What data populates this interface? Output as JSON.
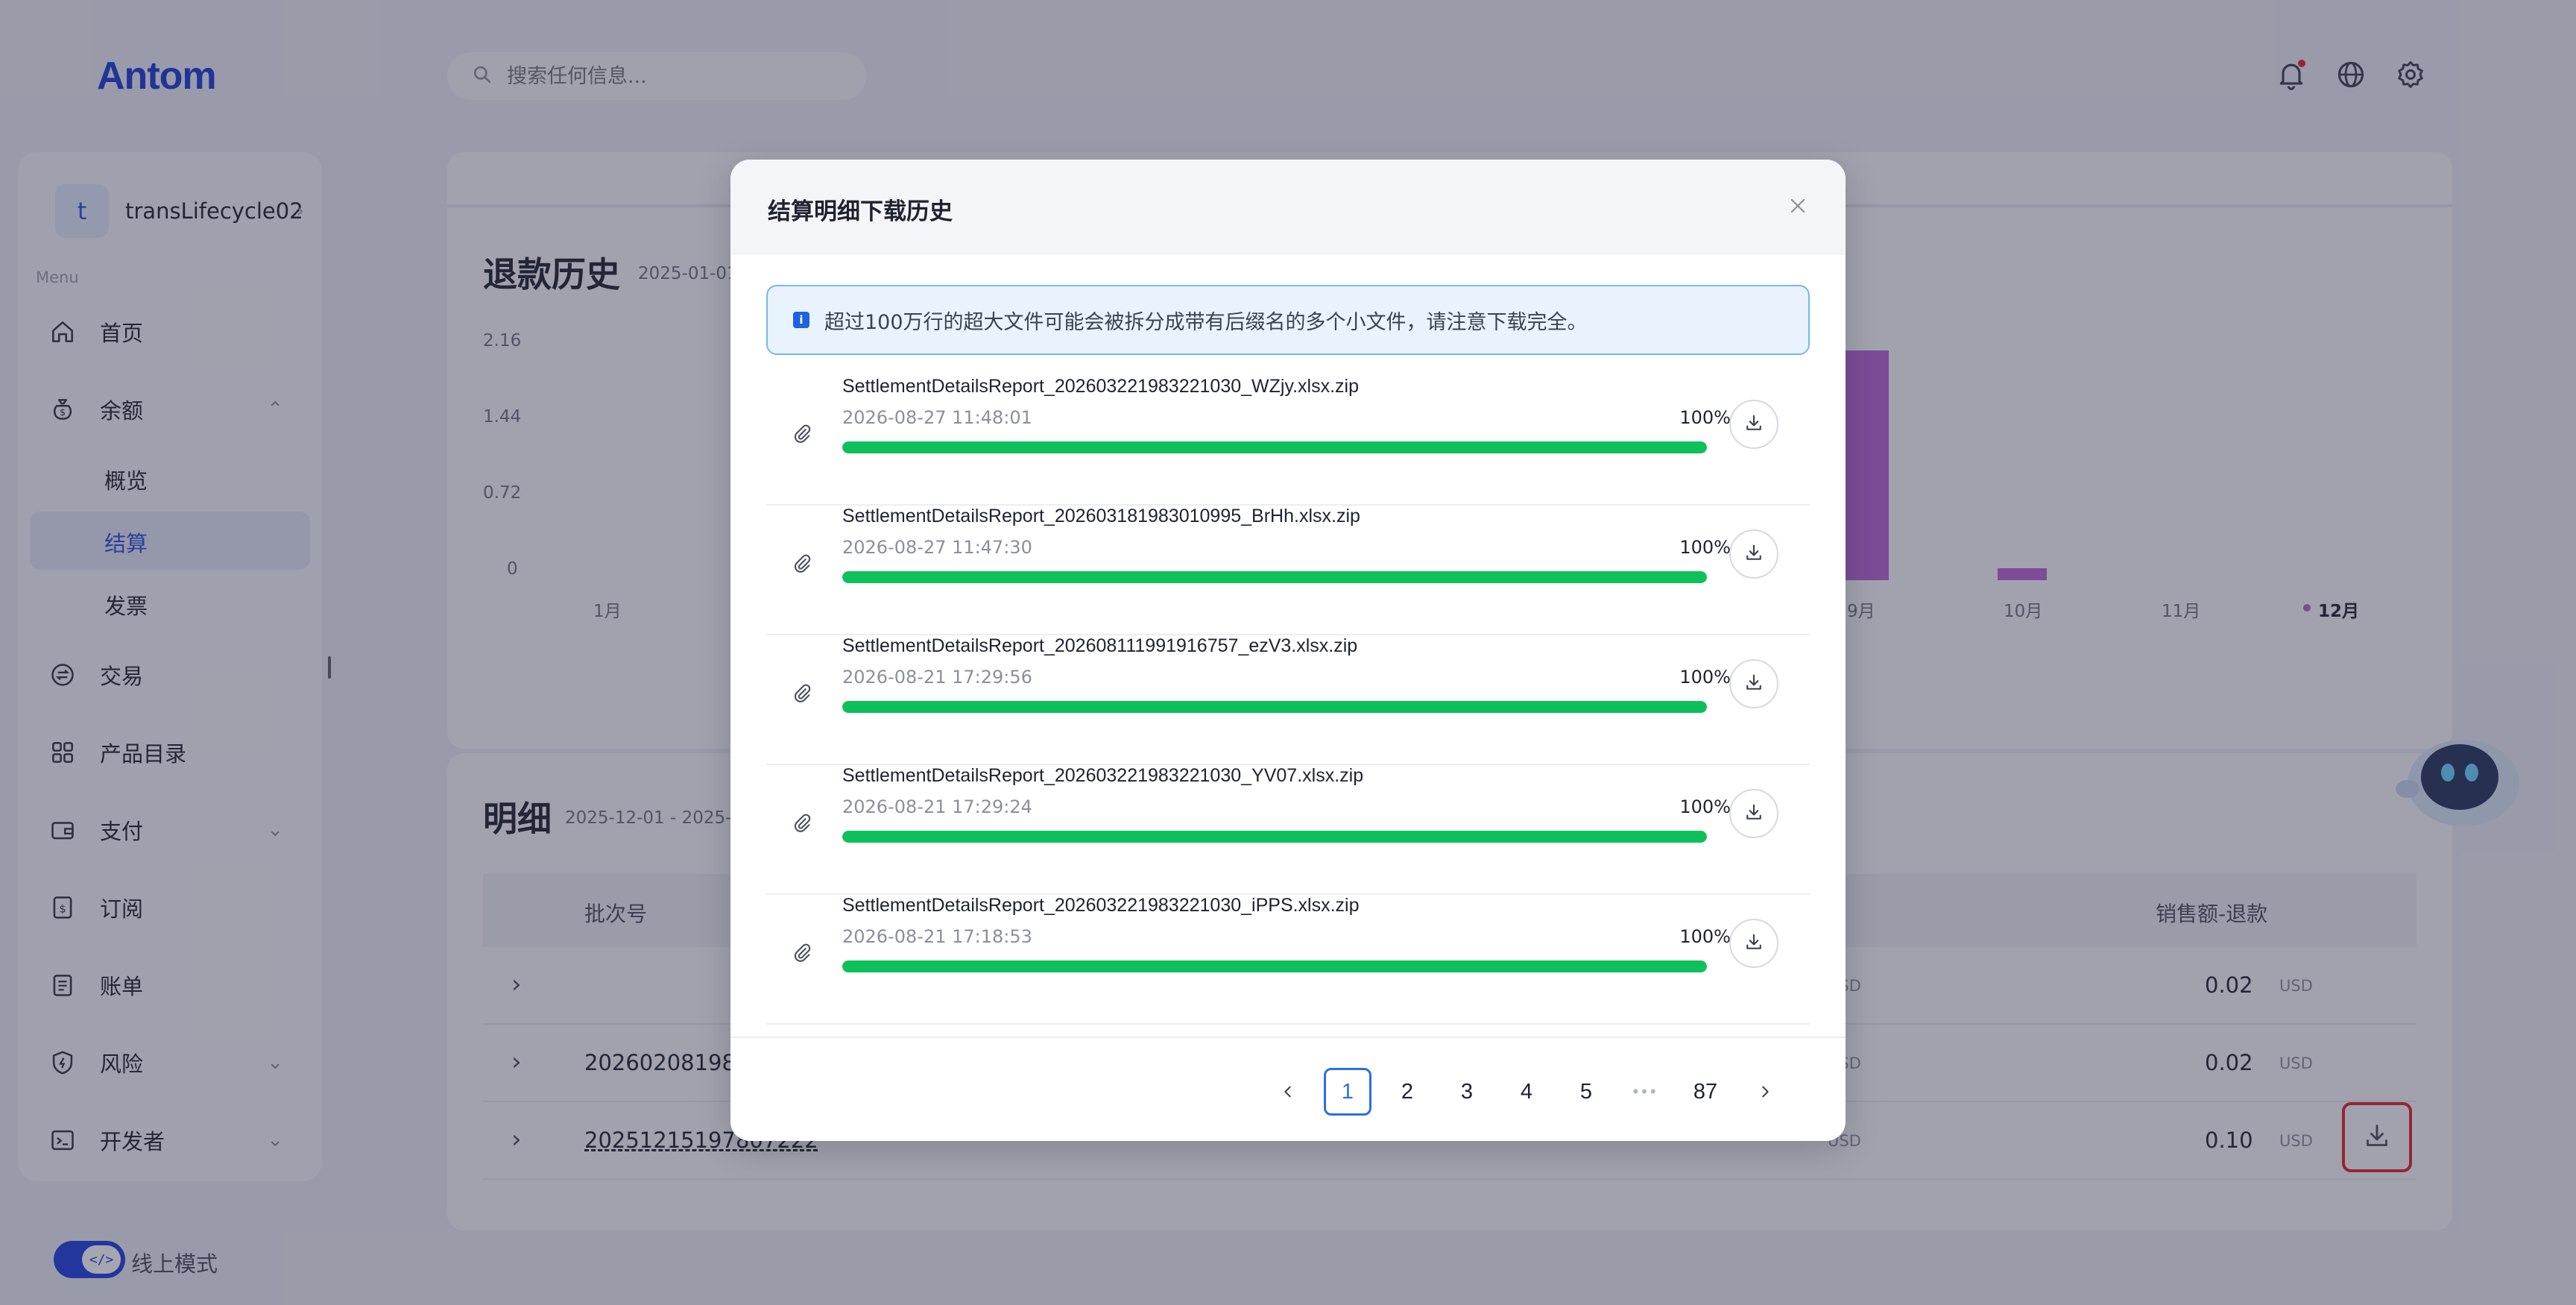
{
  "app": {
    "logo": "Antom"
  },
  "search": {
    "placeholder": "搜索任何信息..."
  },
  "sidebar": {
    "account": {
      "initial": "t",
      "name": "transLifecycle02"
    },
    "menu_label": "Menu",
    "items": {
      "home": "首页",
      "balance": "余额",
      "balance_sub": {
        "overview": "概览",
        "settlement": "结算",
        "invoice": "发票"
      },
      "transactions": "交易",
      "catalog": "产品目录",
      "payments": "支付",
      "subscriptions": "订阅",
      "bills": "账单",
      "risk": "风险",
      "developer": "开发者"
    },
    "mode_label": "线上模式",
    "toggle_glyph": "</>"
  },
  "refund_history": {
    "title": "退款历史",
    "date": "2025-01-01",
    "yticks": [
      "2.16",
      "1.44",
      "0.72",
      "0"
    ],
    "xticks_left": [
      "1月"
    ],
    "xticks_right": [
      "9月",
      "10月",
      "11月",
      "12月"
    ]
  },
  "details": {
    "title": "明细",
    "date": "2025-12-01 - 2025-1",
    "columns": {
      "batch": "批次号",
      "net": "销售额-退款"
    },
    "rows": [
      {
        "batch": "",
        "mid_currency": "USD",
        "net": "0.02",
        "currency": "USD"
      },
      {
        "batch": "202602081980",
        "mid_currency": "USD",
        "net": "0.02",
        "currency": "USD"
      },
      {
        "batch": "20251215197807222",
        "mid_currency": "USD",
        "net": "0.10",
        "currency": "USD"
      }
    ]
  },
  "modal": {
    "title": "结算明细下载历史",
    "notice": "超过100万行的超大文件可能会被拆分成带有后缀名的多个小文件，请注意下载完全。",
    "files": [
      {
        "name": "SettlementDetailsReport_202603221983221030_WZjy.xlsx.zip",
        "time": "2026-08-27 11:48:01",
        "percent_label": "100%",
        "progress": 100
      },
      {
        "name": "SettlementDetailsReport_202603181983010995_BrHh.xlsx.zip",
        "time": "2026-08-27 11:47:30",
        "percent_label": "100%",
        "progress": 100
      },
      {
        "name": "SettlementDetailsReport_202608111991916757_ezV3.xlsx.zip",
        "time": "2026-08-21 17:29:56",
        "percent_label": "100%",
        "progress": 100
      },
      {
        "name": "SettlementDetailsReport_202603221983221030_YV07.xlsx.zip",
        "time": "2026-08-21 17:29:24",
        "percent_label": "100%",
        "progress": 100
      },
      {
        "name": "SettlementDetailsReport_202603221983221030_iPPS.xlsx.zip",
        "time": "2026-08-21 17:18:53",
        "percent_label": "100%",
        "progress": 100
      }
    ],
    "pagination": {
      "pages": [
        "1",
        "2",
        "3",
        "4",
        "5"
      ],
      "ellipsis": "•••",
      "last": "87",
      "current": "1"
    }
  },
  "colors": {
    "accent": "#2c4fe0",
    "progress": "#0ec05a",
    "bar": "#b964d4",
    "highlight": "#e2232b"
  }
}
